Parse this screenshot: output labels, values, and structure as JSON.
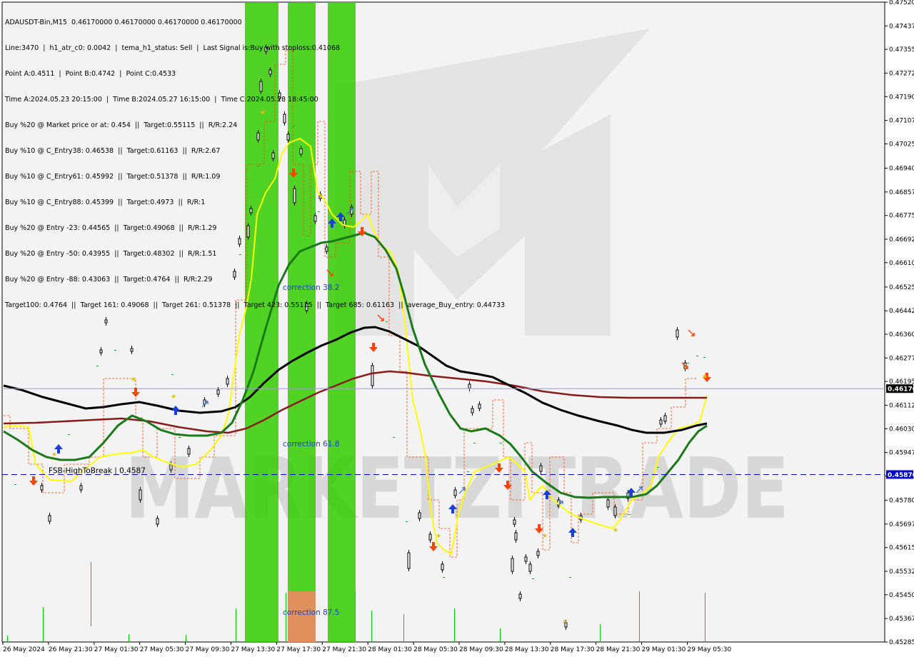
{
  "chart_data": {
    "type": "candlestick",
    "symbol_line": "ADAUSDT-Bin,M15  0.46170000 0.46170000 0.46170000 0.46170000",
    "info_lines": [
      "Line:3470  |  h1_atr_c0: 0.0042  |  tema_h1_status: Sell  |  Last Signal is:Buy with stoploss:0.41068",
      "Point A:0.4511  |  Point B:0.4742  |  Point C:0.4533",
      "Time A:2024.05.23 20:15:00  |  Time B:2024.05.27 16:15:00  |  Time C:2024.05.28 18:45:00",
      "Buy %20 @ Market price or at: 0.454  ||  Target:0.55115  ||  R/R:2.24",
      "Buy %10 @ C_Entry38: 0.46538  ||  Target:0.61163  ||  R/R:2.67",
      "Buy %10 @ C_Entry61: 0.45992  ||  Target:0.51378  ||  R/R:1.09",
      "Buy %10 @ C_Entry88: 0.45399  ||  Target:0.4973  ||  R/R:1",
      "Buy %20 @ Entry -23: 0.44565  ||  Target:0.49068  ||  R/R:1.29",
      "Buy %20 @ Entry -50: 0.43955  ||  Target:0.48302  ||  R/R:1.51",
      "Buy %20 @ Entry -88: 0.43063  ||  Target:0.4764  ||  R/R:2.29",
      "Target100: 0.4764  ||  Target 161: 0.49068  ||  Target 261: 0.51378  ||  Target 423: 0.55115  ||  Target 685: 0.61163  ||  average_Buy_entry: 0.44733"
    ],
    "y_ticks": [
      "0.47520",
      "0.47437",
      "0.47355",
      "0.47272",
      "0.47190",
      "0.47107",
      "0.47025",
      "0.46940",
      "0.46857",
      "0.46775",
      "0.46692",
      "0.46610",
      "0.46525",
      "0.46442",
      "0.46360",
      "0.46277",
      "0.46195",
      "0.46112",
      "0.46030",
      "0.45947",
      "0.45865",
      "0.45780",
      "0.45697",
      "0.45615",
      "0.45532",
      "0.45450",
      "0.45367",
      "0.45285"
    ],
    "x_ticks": [
      "26 May 2024",
      "26 May 21:30",
      "27 May 01:30",
      "27 May 05:30",
      "27 May 09:30",
      "27 May 13:30",
      "27 May 17:30",
      "27 May 21:30",
      "28 May 01:30",
      "28 May 05:30",
      "28 May 09:30",
      "28 May 13:30",
      "28 May 17:30",
      "28 May 21:30",
      "29 May 01:30",
      "29 May 05:30"
    ],
    "y_range": [
      0.45285,
      0.4752
    ],
    "current_price": "0.46170",
    "blue_level": "0.45870",
    "blue_level_label": "FSB-HighToBreak | 0.4587",
    "corrections": [
      "correction 38.2",
      "correction 61.8",
      "correction 87.5"
    ],
    "watermark": "MARKETZITRADE",
    "colors": {
      "green_zone": "#33cc00",
      "orange_zone": "#e0905a",
      "ema_black": "#000000",
      "ema_darkred": "#8b1a1a",
      "ema_green": "#1a7a1a",
      "yellow_line": "#ffff00",
      "stop_line": "#ff4400",
      "blue_level": "#0000cc",
      "buy_arrow": "#1a3fd6",
      "sell_arrow": "#ff4400"
    }
  }
}
